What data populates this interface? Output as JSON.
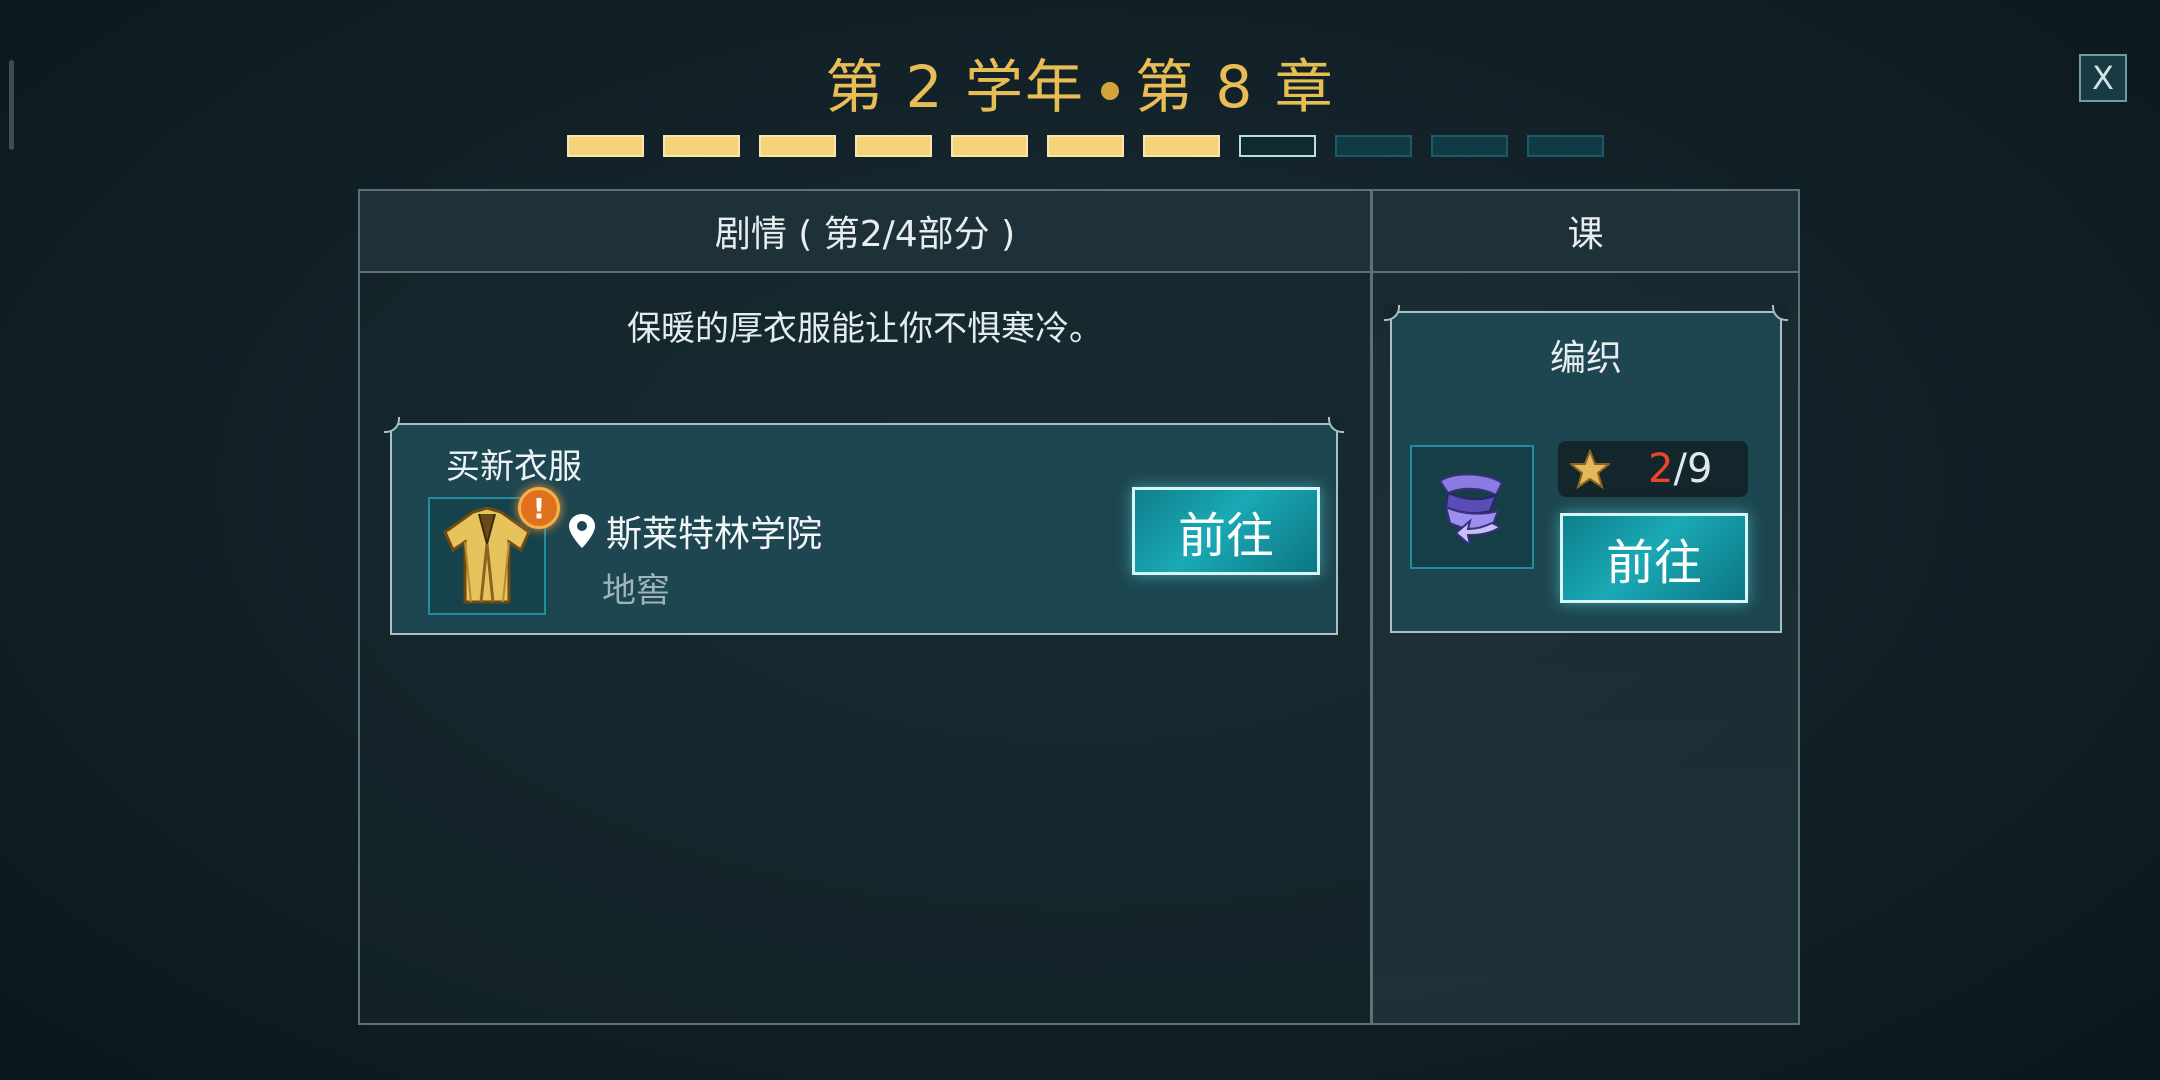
{
  "header": {
    "year_label": "第 2 学年",
    "chapter_label": "第 8 章",
    "close_label": "X"
  },
  "chapter_progress": {
    "total_segments": 11,
    "completed": 7,
    "current_index": 8
  },
  "quest_panel": {
    "header": "剧情 ( 第2/4部分 )",
    "description": "保暖的厚衣服能让你不惧寒冷。",
    "task": {
      "name": "买新衣服",
      "icon": "robe-icon",
      "alert_icon": "!",
      "location": "斯莱特林学院",
      "sub_location": "地窖",
      "go_label": "前往"
    }
  },
  "lesson_panel": {
    "header": "课",
    "lesson": {
      "name": "编织",
      "icon": "ribbon-icon",
      "stars_current": "2",
      "stars_separator": "/",
      "stars_total": "9",
      "go_label": "前往"
    }
  },
  "colors": {
    "gold": "#e9bd55",
    "progress_done": "#f5d37a",
    "button_teal": "#1aa9b5",
    "star_current": "#e8452c",
    "alert": "#e0701c"
  }
}
